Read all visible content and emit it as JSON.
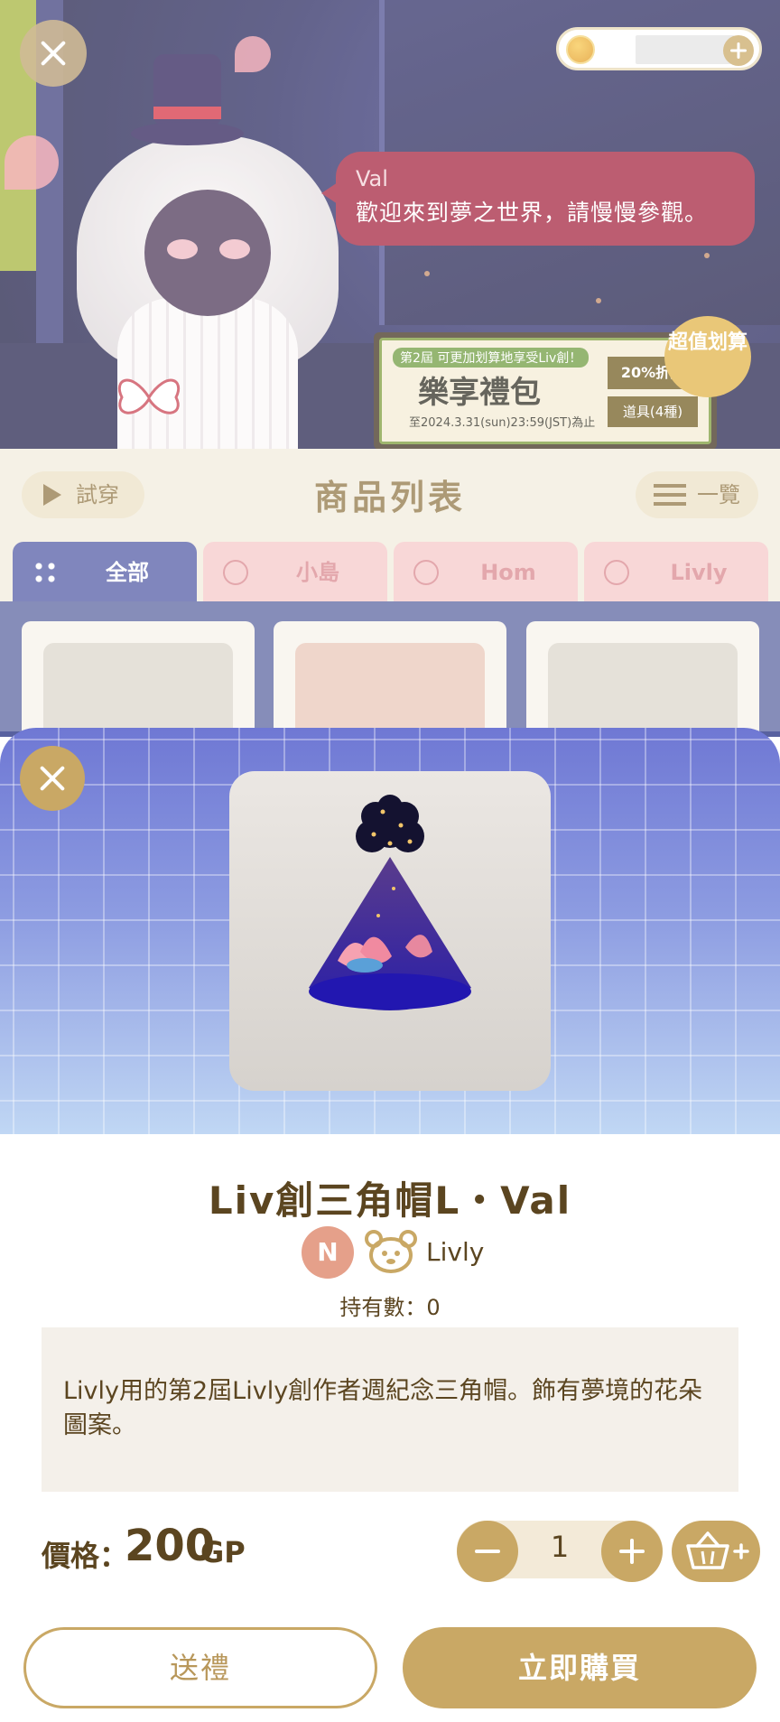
{
  "scene": {
    "speech_name": "Val",
    "speech_text": "歡迎來到夢之世界，請慢慢參觀。",
    "promo_tag": "第2屆 可更加划算地享受Liv創！",
    "promo_title": "樂享禮包",
    "promo_date": "至2024.3.31(sun)23:59(JST)為止",
    "promo_badge1": "20%折扣",
    "promo_badge2": "道具(4種)",
    "deal_badge": "超值划算"
  },
  "shop": {
    "try_on": "試穿",
    "title": "商品列表",
    "list_view": "一覽",
    "tabs": [
      {
        "label": "全部",
        "icon": "grid-icon",
        "active": true
      },
      {
        "label": "小島",
        "icon": "island-icon",
        "active": false
      },
      {
        "label": "Hom",
        "icon": "shirt-icon",
        "active": false
      },
      {
        "label": "Livly",
        "icon": "livly-icon",
        "active": false
      }
    ]
  },
  "product": {
    "name": "Liv創三角帽L・Val",
    "rarity": "N",
    "category": "Livly",
    "owned": "持有數：0",
    "description": "Livly用的第2屆Livly創作者週紀念三角帽。飾有夢境的花朵圖案。",
    "price_label": "價格：",
    "price": "200",
    "price_unit": "GP",
    "quantity": "1"
  },
  "actions": {
    "gift": "送禮",
    "buy": "立即購買"
  },
  "colors": {
    "accent_gold": "#c9a865",
    "text_brown": "#5b4520",
    "tab_active": "#4f58a4",
    "tab_inactive": "#f6c8c8",
    "speech_bg": "#a21f3b"
  }
}
